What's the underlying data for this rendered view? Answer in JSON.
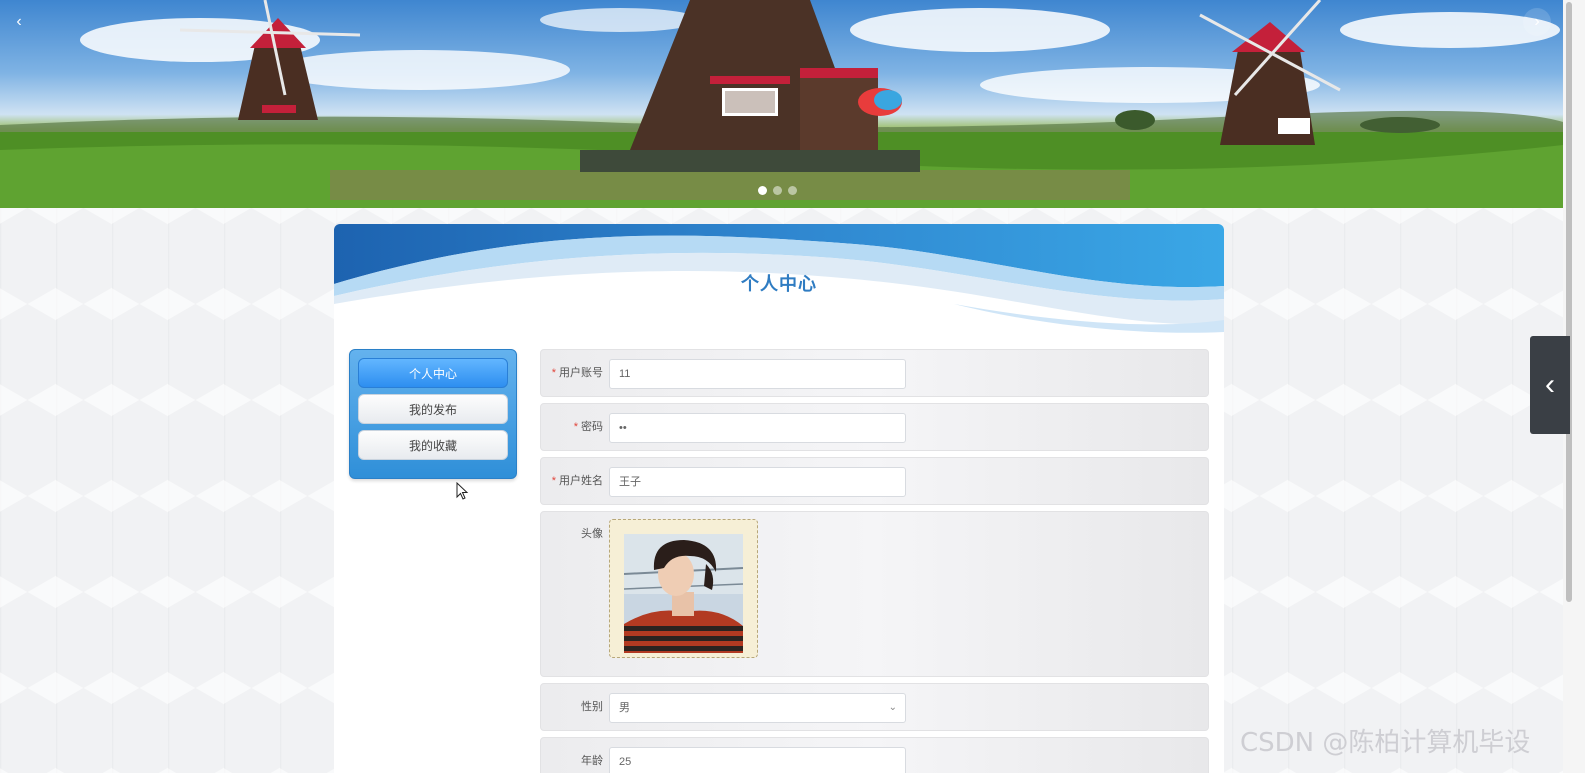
{
  "banner": {
    "prev_icon": "‹",
    "next_icon": "›",
    "slides": 3,
    "active_slide": 1
  },
  "card": {
    "title": "个人中心"
  },
  "menu": {
    "items": [
      {
        "label": "个人中心",
        "active": true
      },
      {
        "label": "我的发布",
        "active": false
      },
      {
        "label": "我的收藏",
        "active": false
      }
    ]
  },
  "form": {
    "account": {
      "label": "用户账号",
      "required": "*",
      "value": "11"
    },
    "password": {
      "label": "密码",
      "required": "*",
      "value": "••"
    },
    "name": {
      "label": "用户姓名",
      "required": "*",
      "value": "王子"
    },
    "avatar": {
      "label": "头像"
    },
    "gender": {
      "label": "性别",
      "value": "男"
    },
    "age": {
      "label": "年龄",
      "value": "25"
    }
  },
  "drawer": {
    "icon": "‹"
  },
  "watermark": "CSDN @陈柏计算机毕设",
  "colors": {
    "accent": "#2f7cc2",
    "menu_active": "#2d8ef0",
    "required": "#e0443a",
    "drawer": "#3a3f45"
  }
}
